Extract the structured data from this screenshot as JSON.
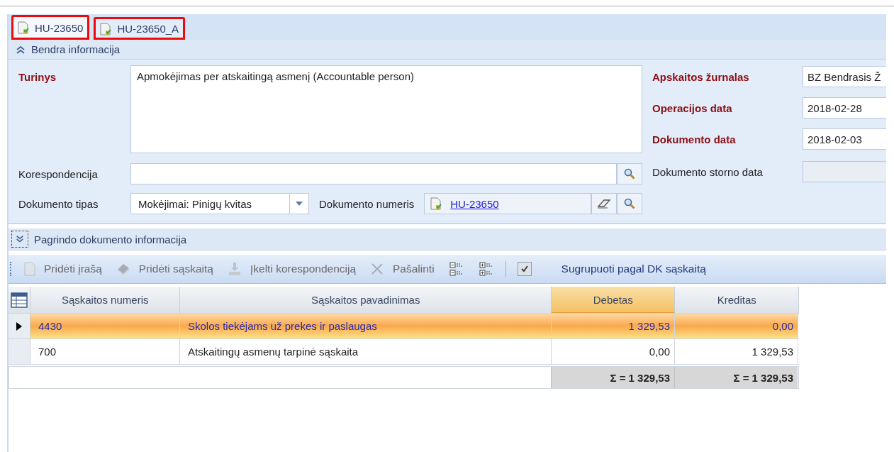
{
  "tabs": [
    {
      "label": "HU-23650",
      "selected": true,
      "highlighted": true
    },
    {
      "label": "HU-23650_A",
      "selected": false,
      "highlighted": true
    }
  ],
  "general_section": {
    "title": "Bendra informacija",
    "expanded": true
  },
  "form": {
    "content": {
      "label": "Turinys",
      "required": true,
      "value": "Apmokėjimas per atskaitingą asmenį (Accountable person)"
    },
    "correspondence": {
      "label": "Korespondencija",
      "required": false
    },
    "document_type": {
      "label": "Dokumento tipas",
      "required": false,
      "value": "Mokėjimai: Pinigų kvitas"
    },
    "document_number": {
      "label": "Dokumento numeris",
      "required": false,
      "value": "HU-23650"
    },
    "right_fields": [
      {
        "label": "Apskaitos žurnalas",
        "required": true,
        "value": "BZ Bendrasis Ž"
      },
      {
        "label": "Operacijos data",
        "required": true,
        "value": "2018-02-28"
      },
      {
        "label": "Dokumento data",
        "required": true,
        "value": "2018-02-03"
      },
      {
        "label": "Dokumento storno data",
        "required": false
      }
    ]
  },
  "basis_section": {
    "title": "Pagrindo dokumento informacija",
    "expanded": false
  },
  "toolbar": [
    {
      "kind": "add",
      "label": "Pridėti įrašą",
      "disabled": true
    },
    {
      "kind": "account",
      "label": "Pridėti sąskaitą",
      "disabled": true
    },
    {
      "kind": "import",
      "label": "Įkelti korespondenciją",
      "disabled": true
    },
    {
      "kind": "delete",
      "label": "Pašalinti",
      "disabled": true
    },
    {
      "kind": "collapse",
      "disabled": false
    },
    {
      "kind": "expand",
      "disabled": false
    },
    {
      "kind": "toggle",
      "label": "Sugrupuoti pagal DK sąskaitą",
      "checked": true,
      "disabled": false
    }
  ],
  "grid": {
    "columns": [
      {
        "label": "Sąskaitos numeris",
        "highlighted": false
      },
      {
        "label": "Sąskaitos pavadinimas",
        "highlighted": false
      },
      {
        "label": "Debetas",
        "highlighted": true
      },
      {
        "label": "Kreditas",
        "highlighted": false
      }
    ],
    "rows": [
      {
        "cells": [
          "4430",
          "Skolos tiekėjams už prekes ir paslaugas",
          "1 329,53",
          "0,00"
        ],
        "selected": true
      },
      {
        "cells": [
          "700",
          "Atskaitingų asmenų tarpinė sąskaita",
          "0,00",
          "1 329,53"
        ],
        "selected": false
      }
    ],
    "totals": [
      "Σ = 1 329,53",
      "Σ = 1 329,53"
    ]
  }
}
